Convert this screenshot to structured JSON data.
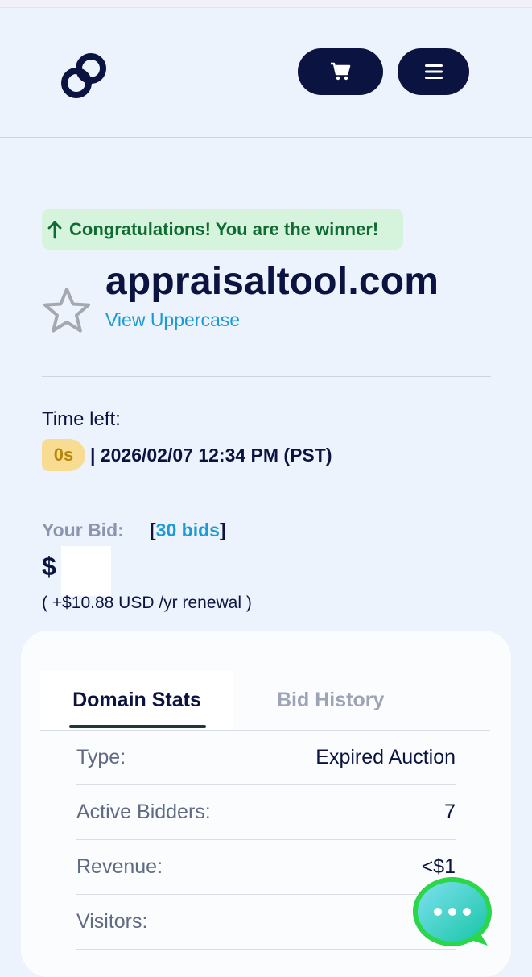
{
  "header": {
    "logo_icon": "link-chain-icon",
    "cart_icon": "cart-icon",
    "menu_icon": "hamburger-menu-icon"
  },
  "winner_banner": {
    "text": "Congratulations! You are the winner!",
    "icon": "arrow-up-icon"
  },
  "domain": {
    "name": "appraisaltool.com",
    "view_uppercase": "View Uppercase",
    "favorite_icon": "star-outline-icon"
  },
  "time": {
    "label": "Time left:",
    "remaining": "0s",
    "end": "| 2026/02/07 12:34 PM (PST)"
  },
  "bid": {
    "label": "Your Bid:",
    "bids_open": "[",
    "bids_count": "30",
    "bids_word": "bids",
    "bids_close": "]",
    "amount_visible": "$",
    "renewal": "( +$10.88 USD /yr renewal )"
  },
  "tabs": [
    {
      "label": "Domain Stats",
      "active": true
    },
    {
      "label": "Bid History",
      "active": false
    }
  ],
  "stats": [
    {
      "key": "Type:",
      "value": "Expired Auction"
    },
    {
      "key": "Active Bidders:",
      "value": "7"
    },
    {
      "key": "Revenue:",
      "value": "<$1"
    },
    {
      "key": "Visitors:",
      "value": ""
    }
  ],
  "chat": {
    "icon": "chat-bubble-icon"
  },
  "colors": {
    "navy": "#0b1440",
    "link": "#1a9ad6",
    "success_bg": "#d6f4dc",
    "success_text": "#0f6a34",
    "timer_bg": "#f7dc91",
    "chat_green": "#2bd64b"
  }
}
